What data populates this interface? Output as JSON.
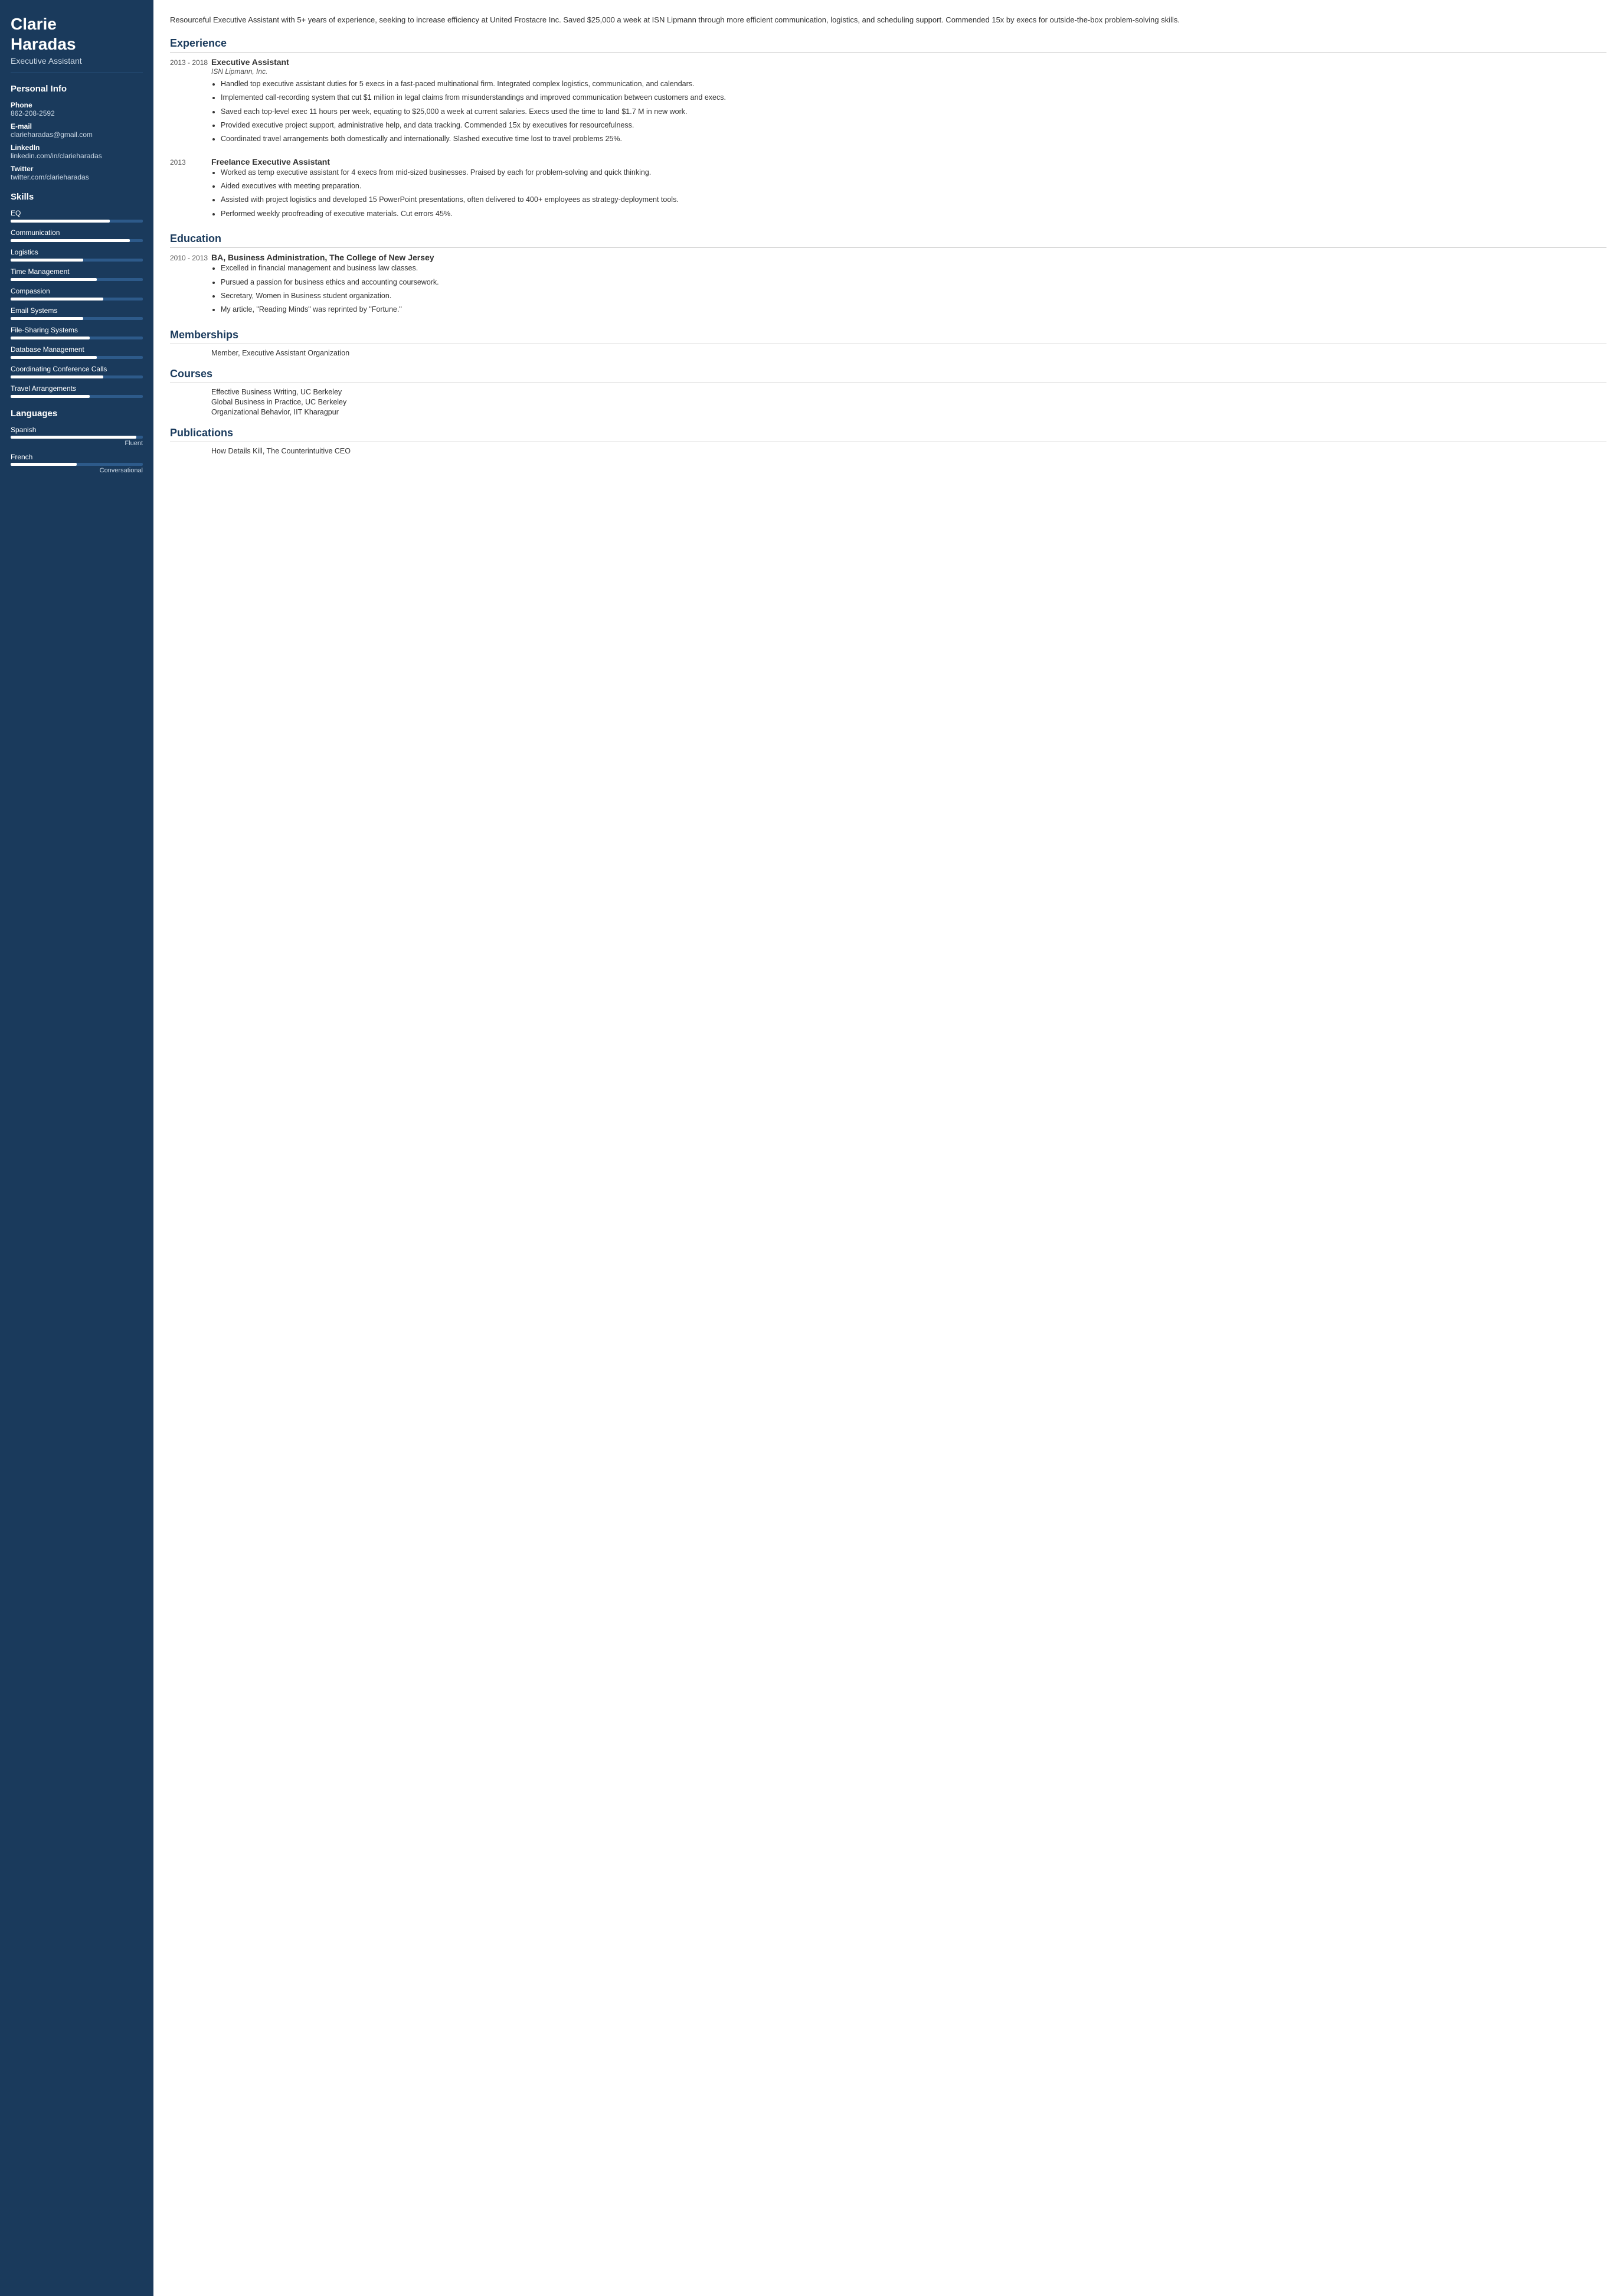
{
  "sidebar": {
    "name_line1": "Clarie",
    "name_line2": "Haradas",
    "title": "Executive Assistant",
    "personal_info_section": "Personal Info",
    "phone_label": "Phone",
    "phone_value": "862-208-2592",
    "email_label": "E-mail",
    "email_value": "clarieharadas@gmail.com",
    "linkedin_label": "LinkedIn",
    "linkedin_value": "linkedin.com/in/clarieharadas",
    "twitter_label": "Twitter",
    "twitter_value": "twitter.com/clarieharadas",
    "skills_section": "Skills",
    "skills": [
      {
        "name": "EQ",
        "pct": 75
      },
      {
        "name": "Communication",
        "pct": 90
      },
      {
        "name": "Logistics",
        "pct": 55
      },
      {
        "name": "Time Management",
        "pct": 65
      },
      {
        "name": "Compassion",
        "pct": 70
      },
      {
        "name": "Email Systems",
        "pct": 55
      },
      {
        "name": "File-Sharing Systems",
        "pct": 60
      },
      {
        "name": "Database Management",
        "pct": 65
      },
      {
        "name": "Coordinating Conference Calls",
        "pct": 70
      },
      {
        "name": "Travel Arrangements",
        "pct": 60
      }
    ],
    "languages_section": "Languages",
    "languages": [
      {
        "name": "Spanish",
        "pct": 95,
        "level": "Fluent"
      },
      {
        "name": "French",
        "pct": 50,
        "level": "Conversational"
      }
    ]
  },
  "main": {
    "summary": "Resourceful Executive Assistant with 5+ years of experience, seeking to increase efficiency at United Frostacre Inc. Saved $25,000 a week at ISN Lipmann through more efficient communication, logistics, and scheduling support. Commended 15x by execs for outside-the-box problem-solving skills.",
    "experience_title": "Experience",
    "experience_entries": [
      {
        "date": "2013 - 2018",
        "job_title": "Executive Assistant",
        "company": "ISN Lipmann, Inc.",
        "bullets": [
          "Handled top executive assistant duties for 5 execs in a fast-paced multinational firm. Integrated complex logistics, communication, and calendars.",
          "Implemented call-recording system that cut $1 million in legal claims from misunderstandings and improved communication between customers and execs.",
          "Saved each top-level exec 11 hours per week, equating to $25,000 a week at current salaries. Execs used the time to land $1.7 M in new work.",
          "Provided executive project support, administrative help, and data tracking. Commended 15x by executives for resourcefulness.",
          "Coordinated travel arrangements both domestically and internationally. Slashed executive time lost to travel problems 25%."
        ]
      },
      {
        "date": "2013",
        "job_title": "Freelance Executive Assistant",
        "company": "",
        "bullets": [
          "Worked as temp executive assistant for 4 execs from mid-sized businesses. Praised by each for problem-solving and quick thinking.",
          "Aided executives with meeting preparation.",
          "Assisted with project logistics and developed 15 PowerPoint presentations, often delivered to 400+ employees as strategy-deployment tools.",
          "Performed weekly proofreading of executive materials. Cut errors 45%."
        ]
      }
    ],
    "education_title": "Education",
    "education_entries": [
      {
        "date": "2010 - 2013",
        "degree": "BA, Business Administration, The College of New Jersey",
        "bullets": [
          "Excelled in financial management and business law classes.",
          "Pursued a passion for business ethics and accounting coursework.",
          "Secretary, Women in Business student organization.",
          "My article, \"Reading Minds\" was reprinted by \"Fortune.\""
        ]
      }
    ],
    "memberships_title": "Memberships",
    "memberships": [
      "Member, Executive Assistant Organization"
    ],
    "courses_title": "Courses",
    "courses": [
      "Effective Business Writing, UC Berkeley",
      "Global Business in Practice, UC Berkeley",
      "Organizational Behavior, IIT Kharagpur"
    ],
    "publications_title": "Publications",
    "publications": [
      "How Details Kill, The Counterintuitive CEO"
    ]
  }
}
